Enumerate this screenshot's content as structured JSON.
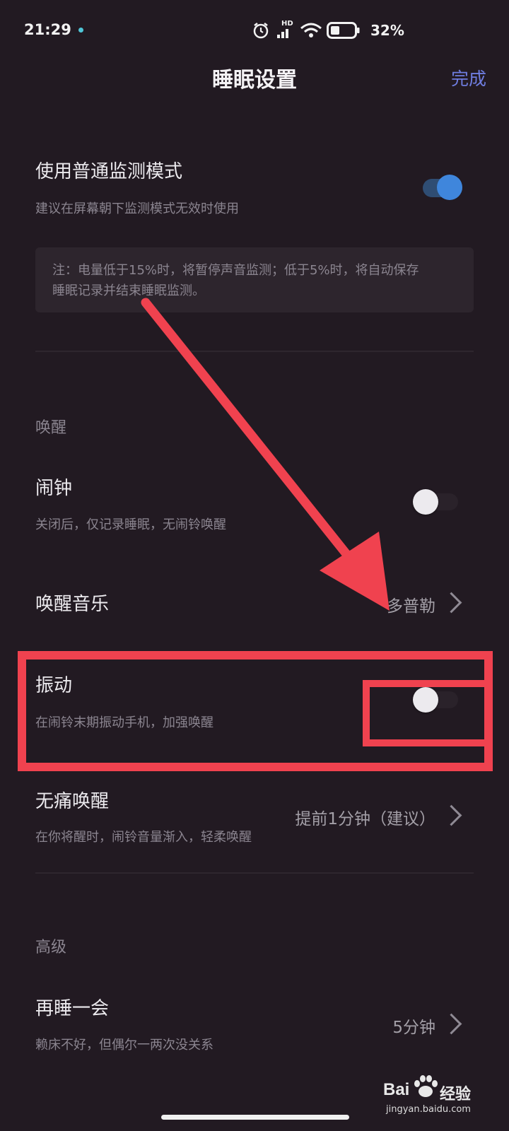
{
  "status_bar": {
    "time": "21:29",
    "battery": "32%",
    "hd": "HD",
    "icons": [
      "alarm-icon",
      "signal-icon",
      "wifi-icon",
      "battery-icon"
    ]
  },
  "header": {
    "title": "睡眠设置",
    "done": "完成"
  },
  "normal_mode": {
    "title": "使用普通监测模式",
    "subtitle": "建议在屏幕朝下监测模式无效时使用",
    "enabled": true,
    "note_line1": "注：电量低于15%时，将暂停声音监测；低于5%时，将自动保存",
    "note_line2": "睡眠记录并结束睡眠监测。"
  },
  "wake_section": {
    "heading": "唤醒",
    "alarm": {
      "title": "闹钟",
      "subtitle": "关闭后，仅记录睡眠，无闹铃唤醒",
      "enabled": false
    },
    "music": {
      "title": "唤醒音乐",
      "value": "多普勒"
    },
    "vibration": {
      "title": "振动",
      "subtitle": "在闹铃末期振动手机，加强唤醒",
      "enabled": false
    },
    "gentle": {
      "title": "无痛唤醒",
      "subtitle": "在你将醒时，闹铃音量渐入，轻柔唤醒",
      "value": "提前1分钟（建议）"
    }
  },
  "advanced_section": {
    "heading": "高级",
    "snooze": {
      "title": "再睡一会",
      "subtitle": "赖床不好，但偶尔一两次没关系",
      "value": "5分钟"
    }
  },
  "watermark": {
    "brand": "Bai",
    "brand2": "经验",
    "url": "jingyan.baidu.com"
  },
  "colors": {
    "background": "#221a22",
    "accent": "#6f7de0",
    "toggle_on": "#3f86dc",
    "annotation": "#f0424f"
  }
}
